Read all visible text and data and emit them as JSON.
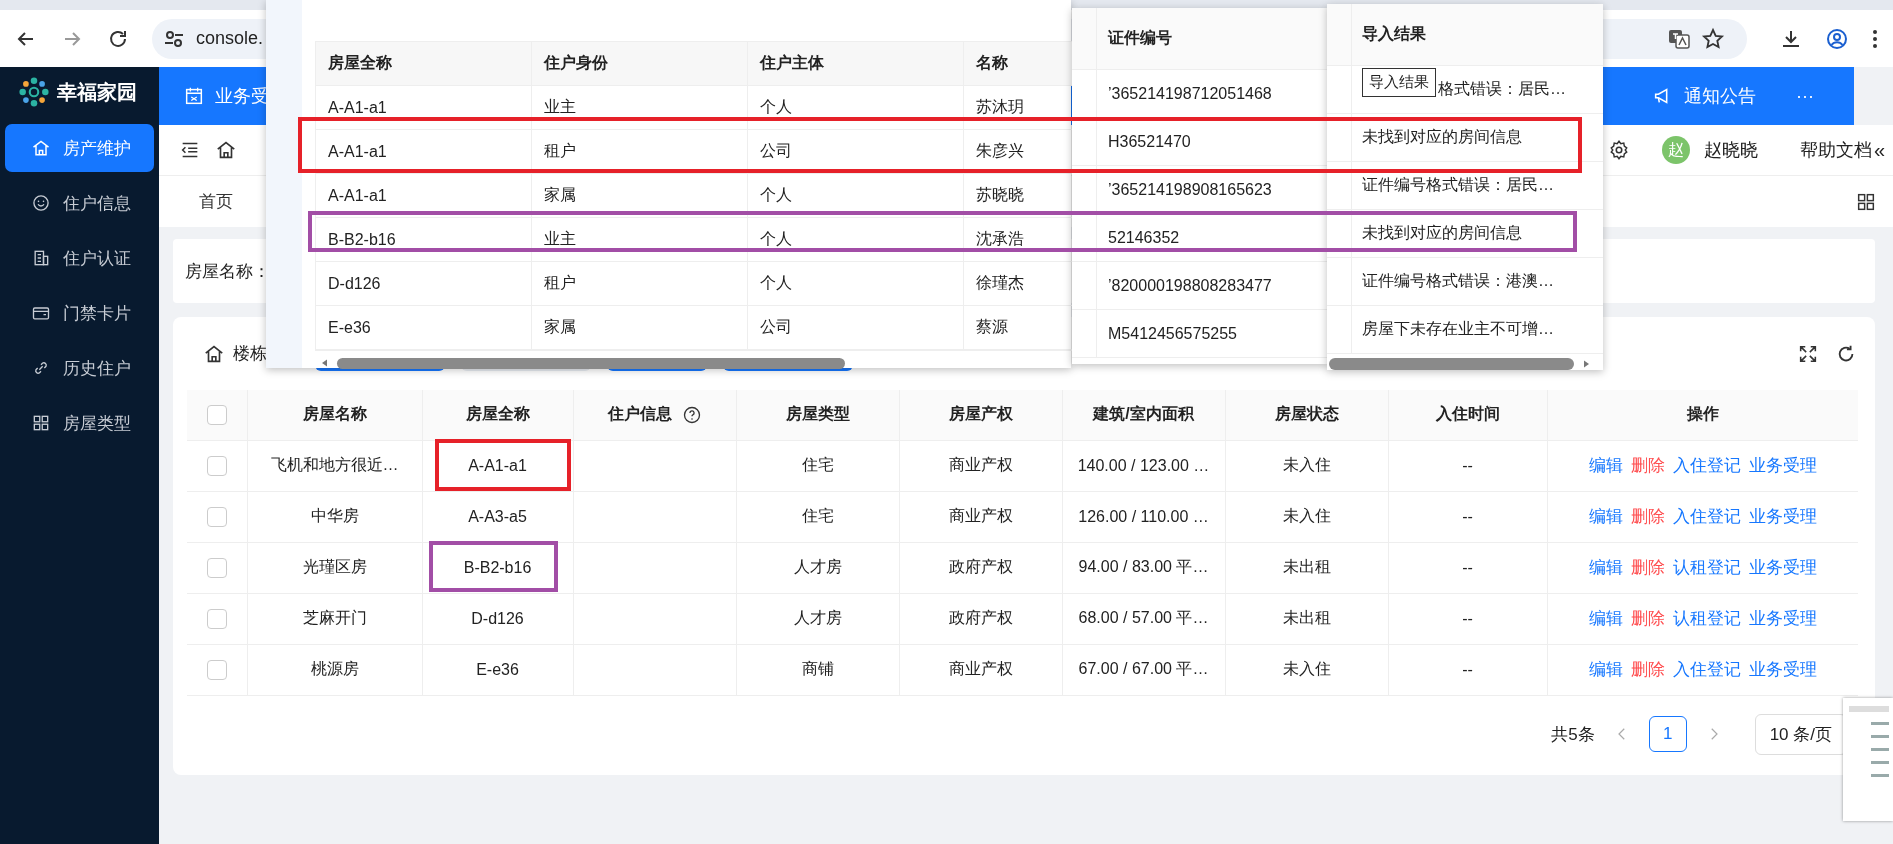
{
  "browser": {
    "address": "console."
  },
  "sidebar": {
    "logo": "幸福家园",
    "items": [
      {
        "label": "房产维护",
        "selected": true
      },
      {
        "label": "住户信息",
        "selected": false
      },
      {
        "label": "住户认证",
        "selected": false
      },
      {
        "label": "门禁卡片",
        "selected": false
      },
      {
        "label": "历史住户",
        "selected": false
      },
      {
        "label": "房屋类型",
        "selected": false
      }
    ]
  },
  "header": {
    "left_item": "业务受",
    "right_item": "通知公告",
    "more": "···"
  },
  "toolbar": {
    "user_initial": "赵",
    "user_name": "赵晓晓",
    "help": "帮助文档",
    "collapse": "«"
  },
  "page_tabs": [
    {
      "label": "首页",
      "selected": false
    }
  ],
  "search": {
    "label": "房屋名称："
  },
  "card": {
    "title": "楼栋"
  },
  "table": {
    "select_all_checked": false,
    "columns": [
      "房屋名称",
      "房屋全称",
      "住户信息",
      "房屋类型",
      "房屋产权",
      "建筑/室内面积",
      "房屋状态",
      "入住时间",
      "操作"
    ],
    "rows": [
      {
        "checked": false,
        "cells": [
          "飞机和地方很近…",
          "A-A1-a1",
          "",
          "住宅",
          "商业产权",
          "140.00 / 123.00 …",
          "未入住",
          "--"
        ],
        "actions": [
          {
            "label": "编辑",
            "kind": "link"
          },
          {
            "label": "删除",
            "kind": "danger"
          },
          {
            "label": "入住登记",
            "kind": "link"
          },
          {
            "label": "业务受理",
            "kind": "link"
          }
        ]
      },
      {
        "checked": false,
        "cells": [
          "中华房",
          "A-A3-a5",
          "",
          "住宅",
          "商业产权",
          "126.00 / 110.00 …",
          "未入住",
          "--"
        ],
        "actions": [
          {
            "label": "编辑",
            "kind": "link"
          },
          {
            "label": "删除",
            "kind": "danger"
          },
          {
            "label": "入住登记",
            "kind": "link"
          },
          {
            "label": "业务受理",
            "kind": "link"
          }
        ]
      },
      {
        "checked": false,
        "cells": [
          "光瑾区房",
          "B-B2-b16",
          "",
          "人才房",
          "政府产权",
          "94.00 / 83.00 平…",
          "未出租",
          "--"
        ],
        "actions": [
          {
            "label": "编辑",
            "kind": "link"
          },
          {
            "label": "删除",
            "kind": "danger"
          },
          {
            "label": "认租登记",
            "kind": "link"
          },
          {
            "label": "业务受理",
            "kind": "link"
          }
        ]
      },
      {
        "checked": false,
        "cells": [
          "芝麻开门",
          "D-d126",
          "",
          "人才房",
          "政府产权",
          "68.00 / 57.00 平…",
          "未出租",
          "--"
        ],
        "actions": [
          {
            "label": "编辑",
            "kind": "link"
          },
          {
            "label": "删除",
            "kind": "danger"
          },
          {
            "label": "认租登记",
            "kind": "link"
          },
          {
            "label": "业务受理",
            "kind": "link"
          }
        ]
      },
      {
        "checked": false,
        "cells": [
          "桃源房",
          "E-e36",
          "",
          "商铺",
          "商业产权",
          "67.00 / 67.00 平…",
          "未入住",
          "--"
        ],
        "actions": [
          {
            "label": "编辑",
            "kind": "link"
          },
          {
            "label": "删除",
            "kind": "danger"
          },
          {
            "label": "入住登记",
            "kind": "link"
          },
          {
            "label": "业务受理",
            "kind": "link"
          }
        ]
      }
    ]
  },
  "pagination": {
    "total": "共5条",
    "pages": [
      {
        "label": "1",
        "selected": true
      }
    ],
    "page_size": "10 条/页"
  },
  "import_preview": {
    "columns": [
      "房屋全称",
      "住户身份",
      "住户主体",
      "名称"
    ],
    "rows": [
      [
        "A-A1-a1",
        "业主",
        "个人",
        "苏沐玥"
      ],
      [
        "A-A1-a1",
        "租户",
        "公司",
        "朱彦兴"
      ],
      [
        "A-A1-a1",
        "家属",
        "个人",
        "苏晓晓"
      ],
      [
        "B-B2-b16",
        "业主",
        "个人",
        "沈承浩"
      ],
      [
        "D-d126",
        "租户",
        "个人",
        "徐瑾杰"
      ],
      [
        "E-e36",
        "家属",
        "公司",
        "蔡源"
      ]
    ]
  },
  "id_panel": {
    "column": "证件编号",
    "rows": [
      "’365214198712051468",
      "H36521470",
      "’365214198908165623",
      "52146352",
      "’820000198808283477",
      "M5412456575255"
    ]
  },
  "result_panel": {
    "column": "导入结果",
    "tooltip": "导入结果",
    "rows": [
      "格式错误：居民…",
      "未找到对应的房间信息",
      "证件编号格式错误：居民…",
      "未找到对应的房间信息",
      "证件编号格式错误：港澳…",
      "房屋下未存在业主不可增…"
    ]
  },
  "annotations": [
    {
      "color": "#e62129"
    },
    {
      "color": "#a24ea6"
    },
    {
      "color": "#e62129"
    },
    {
      "color": "#a24ea6"
    }
  ]
}
